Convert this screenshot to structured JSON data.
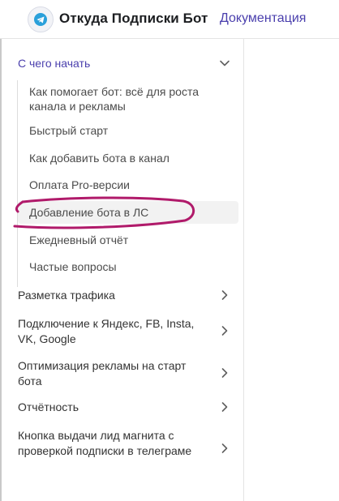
{
  "header": {
    "brand": "Откуда Подписки Бот",
    "docs_link": "Документация"
  },
  "sidebar": {
    "open_category": {
      "label": "С чего начать",
      "items": [
        {
          "label": "Как помогает бот: всё для роста канала и рекламы"
        },
        {
          "label": "Быстрый старт"
        },
        {
          "label": "Как добавить бота в канал"
        },
        {
          "label": "Оплата Pro-версии"
        },
        {
          "label": "Добавление бота в ЛС",
          "active": true
        },
        {
          "label": "Ежедневный отчёт"
        },
        {
          "label": "Частые вопросы"
        }
      ]
    },
    "categories": [
      {
        "label": "Разметка трафика"
      },
      {
        "label": "Подключение к Яндекс, FB, Insta, VK, Google"
      },
      {
        "label": "Оптимизация рекламы на старт бота"
      },
      {
        "label": "Отчётность"
      },
      {
        "label": "Кнопка выдачи лид магнита с проверкой подписки в телеграме"
      }
    ]
  },
  "colors": {
    "accent": "#4a3fad",
    "annotation": "#b01a6a",
    "active_bg": "#f2f2f2"
  }
}
